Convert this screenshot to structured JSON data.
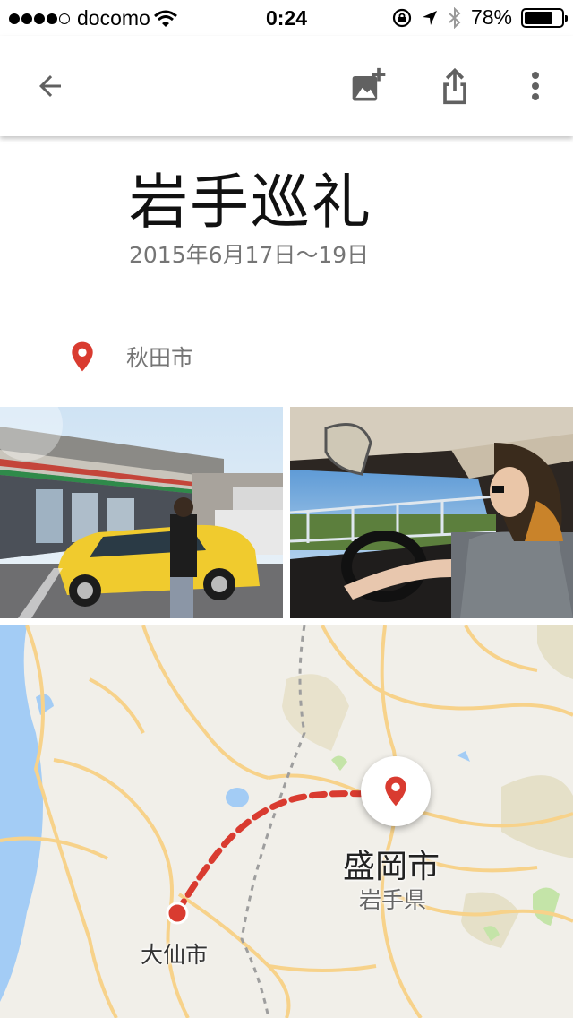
{
  "status_bar": {
    "carrier": "docomo",
    "time": "0:24",
    "battery_percent": "78%",
    "battery_level": 0.78,
    "signal_bars_filled": 4,
    "signal_bars_total": 5
  },
  "toolbar": {
    "back_icon": "arrow-back-icon",
    "add_photo_icon": "add-photo-icon",
    "share_icon": "share-icon",
    "more_icon": "more-vert-icon"
  },
  "album": {
    "title": "岩手巡礼",
    "date_range": "2015年6月17日〜19日",
    "location": "秋田市"
  },
  "photos": [
    {
      "description_icon": "photo-convenience-store"
    },
    {
      "description_icon": "photo-car-driver"
    }
  ],
  "map": {
    "destination_city": "盛岡市",
    "destination_prefecture": "岩手県",
    "start_city": "大仙市",
    "route_color": "#d93b30"
  },
  "colors": {
    "pin_red": "#d93b30",
    "secondary_text": "#757575",
    "icon_gray": "#616161"
  }
}
